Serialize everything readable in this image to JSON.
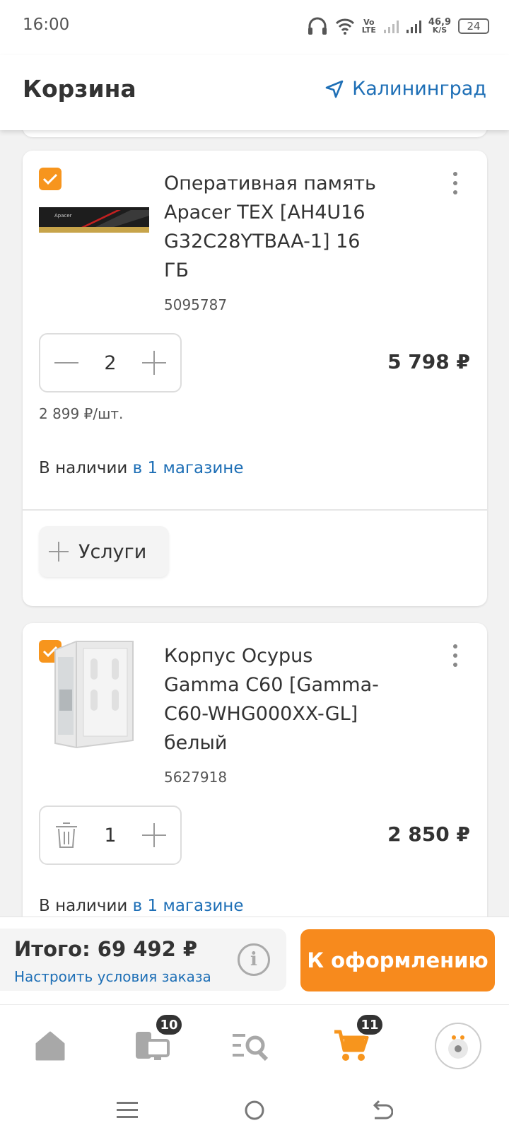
{
  "status_bar": {
    "time": "16:00",
    "network_type": "Vo\nLTE",
    "speed_value": "46,9",
    "speed_unit": "K/S",
    "battery": "24"
  },
  "header": {
    "title": "Корзина",
    "city": "Калининград"
  },
  "cart_items": [
    {
      "name": "Оперативная память Apacer TEX [AH4U16 G32C28YTBAA-1] 16 ГБ",
      "code": "5095787",
      "quantity": "2",
      "price": "5 798 ₽",
      "unit_price": "2 899 ₽/шт.",
      "availability_prefix": "В наличии",
      "availability_link": "в 1 магазине",
      "services_label": "Услуги",
      "checked": true,
      "image_icon": "ram-module-image"
    },
    {
      "name": "Корпус Ocypus Gamma C60 [Gamma-C60-WHG000XX-GL] белый",
      "code": "5627918",
      "quantity": "1",
      "price": "2 850 ₽",
      "availability_prefix": "В наличии",
      "availability_link": "в 1 магазине",
      "checked": true,
      "image_icon": "pc-case-image"
    }
  ],
  "summary": {
    "total_label": "Итого: 69 492 ₽",
    "order_settings_link": "Настроить условия заказа",
    "checkout_label": "К оформлению"
  },
  "bottom_nav": {
    "items": [
      {
        "icon": "home-icon",
        "badge": ""
      },
      {
        "icon": "compare-icon",
        "badge": "10"
      },
      {
        "icon": "catalog-search-icon",
        "badge": ""
      },
      {
        "icon": "cart-icon",
        "badge": "11",
        "active": true
      },
      {
        "icon": "profile-avatar-icon",
        "badge": ""
      }
    ]
  },
  "colors": {
    "accent": "#f7951d",
    "link": "#1e6fb6",
    "checkout": "#f78a1d"
  }
}
